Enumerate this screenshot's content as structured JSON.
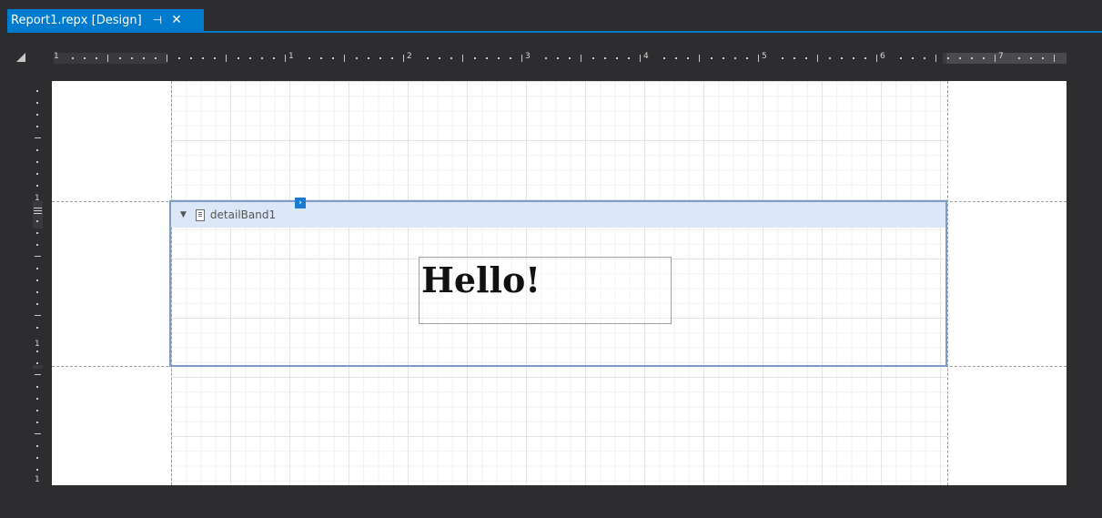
{
  "document_tab": {
    "title": "Report1.repx [Design]",
    "pin_icon": "⊣",
    "close_icon": "✕"
  },
  "ruler": {
    "horizontal_labels": [
      "1",
      "1",
      "2",
      "3",
      "4",
      "5",
      "6",
      "7"
    ],
    "vertical_labels": [
      "1",
      "1",
      "1"
    ]
  },
  "band": {
    "toggle_icon": "▼",
    "name": "detailBand1",
    "smart_tag_icon": "›"
  },
  "label": {
    "text": "Hello!"
  },
  "colors": {
    "accent": "#007acc",
    "band_border": "#7f9cc8",
    "band_header": "#dce8f8",
    "background": "#2d2d30"
  }
}
